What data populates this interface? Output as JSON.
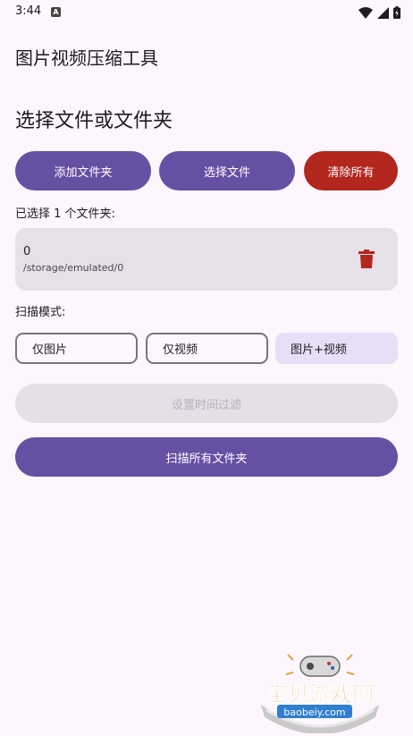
{
  "status_bar": {
    "time": "3:44",
    "notification_letter": "A"
  },
  "app": {
    "title": "图片视频压缩工具"
  },
  "select_section": {
    "title": "选择文件或文件夹",
    "add_folder_label": "添加文件夹",
    "select_file_label": "选择文件",
    "clear_all_label": "清除所有"
  },
  "selection": {
    "summary": "已选择 1 个文件夹:",
    "folders": [
      {
        "name": "0",
        "path": "/storage/emulated/0"
      }
    ]
  },
  "scan_mode": {
    "label": "扫描模式:",
    "options": [
      "仅图片",
      "仅视频",
      "图片+视频"
    ],
    "selected": "图片+视频"
  },
  "time_filter": {
    "label": "设置时间过滤"
  },
  "scan_all": {
    "label": "扫描所有文件夹"
  },
  "watermark": {
    "brand": "宝贝游戏网",
    "domain": "baobeiy.com"
  },
  "colors": {
    "primary": "#6750a4",
    "danger": "#b3261e",
    "background": "#fdf7fd",
    "card": "#e6e0e9",
    "chip_selected": "#e8def8"
  }
}
